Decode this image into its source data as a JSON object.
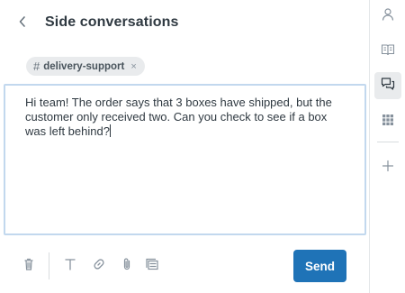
{
  "header": {
    "title": "Side conversations",
    "back_icon": "chevron-left-icon"
  },
  "tag": {
    "hash": "#",
    "label": "delivery-support",
    "remove": "×"
  },
  "editor": {
    "text": "Hi team! The order says that 3 boxes have shipped, but the customer only received two. Can you check to see if a box was left behind?"
  },
  "toolbar": {
    "tools": [
      "trash-icon",
      "text-format-icon",
      "link-icon",
      "attachment-icon",
      "macro-icon"
    ],
    "send_label": "Send"
  },
  "rail": {
    "items": [
      "user-icon",
      "knowledge-book-icon",
      "side-conversations-icon",
      "apps-grid-icon",
      "add-icon"
    ],
    "active": "side-conversations-icon"
  },
  "colors": {
    "primary": "#1f73b7",
    "text": "#2f3941",
    "editor_border": "#c2d8ee",
    "tag_bg": "#e9ebed",
    "icon": "#87929d"
  }
}
